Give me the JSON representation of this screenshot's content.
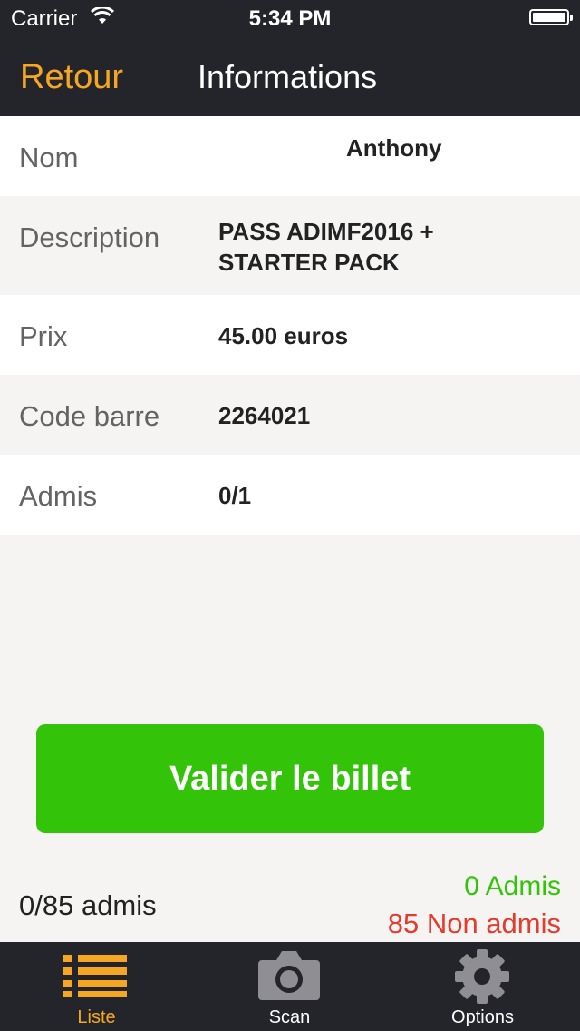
{
  "status_bar": {
    "carrier": "Carrier",
    "time": "5:34 PM"
  },
  "nav": {
    "back_label": "Retour",
    "title": "Informations"
  },
  "details": [
    {
      "label": "Nom",
      "value": "Anthony"
    },
    {
      "label": "Description",
      "value": "PASS ADIMF2016 + STARTER PACK"
    },
    {
      "label": "Prix",
      "value": "45.00 euros"
    },
    {
      "label": "Code barre",
      "value": "2264021"
    },
    {
      "label": "Admis",
      "value": "0/1"
    }
  ],
  "validate_button": {
    "label": "Valider le billet"
  },
  "summary": {
    "total": "0/85 admis",
    "admis": "0 Admis",
    "non_admis": "85 Non admis"
  },
  "tabs": [
    {
      "label": "Liste",
      "icon": "list-icon",
      "active": true
    },
    {
      "label": "Scan",
      "icon": "camera-icon",
      "active": false
    },
    {
      "label": "Options",
      "icon": "gear-icon",
      "active": false
    }
  ],
  "colors": {
    "accent": "#f5a623",
    "bar_bg": "#23252b",
    "button_green": "#33c40a",
    "admis_green": "#33c40a",
    "non_admis_red": "#e53b2c",
    "inactive_icon": "#8e8e93"
  }
}
